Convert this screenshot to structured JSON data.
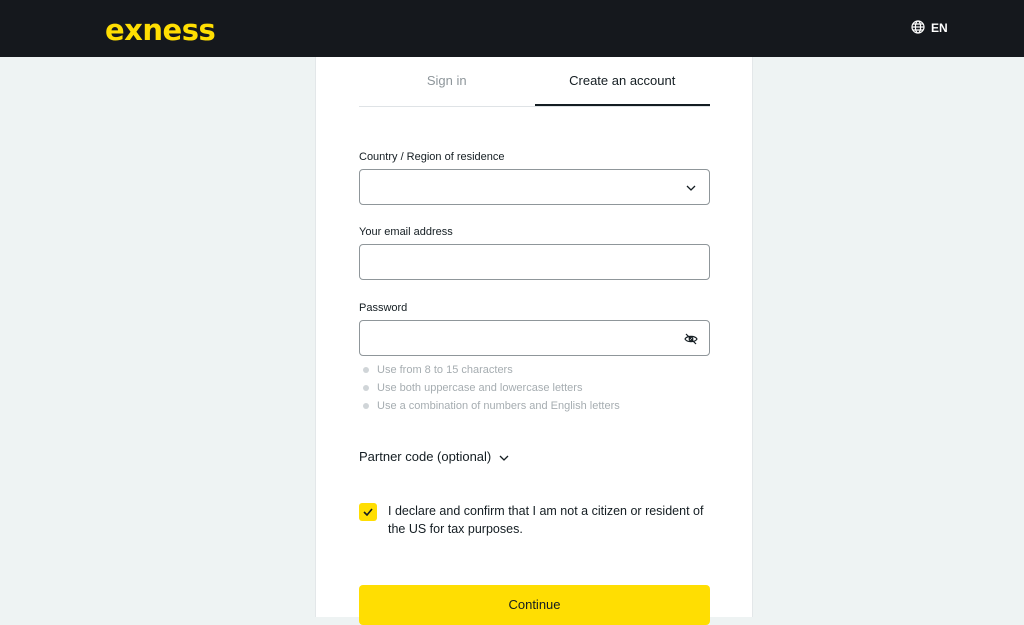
{
  "header": {
    "logo_text": "exness",
    "language": "EN",
    "language_icon": "globe-icon"
  },
  "tabs": [
    {
      "label": "Sign in",
      "active": false
    },
    {
      "label": "Create an account",
      "active": true
    }
  ],
  "form": {
    "country": {
      "label": "Country / Region of residence",
      "value": "",
      "icon": "chevron-down-icon"
    },
    "email": {
      "label": "Your email address",
      "value": ""
    },
    "password": {
      "label": "Password",
      "value": "",
      "icon": "eye-slash-icon"
    },
    "password_hints": [
      "Use from 8 to 15 characters",
      "Use both uppercase and lowercase letters",
      "Use a combination of numbers and English letters"
    ],
    "partner_code_label": "Partner code (optional)",
    "declaration": {
      "checked": true,
      "text": "I declare and confirm that I am not a citizen or resident of the US for tax purposes."
    },
    "submit_label": "Continue"
  },
  "colors": {
    "brand_yellow": "#ffde02",
    "header_bg": "#15181d",
    "page_bg": "#eef3f3"
  }
}
